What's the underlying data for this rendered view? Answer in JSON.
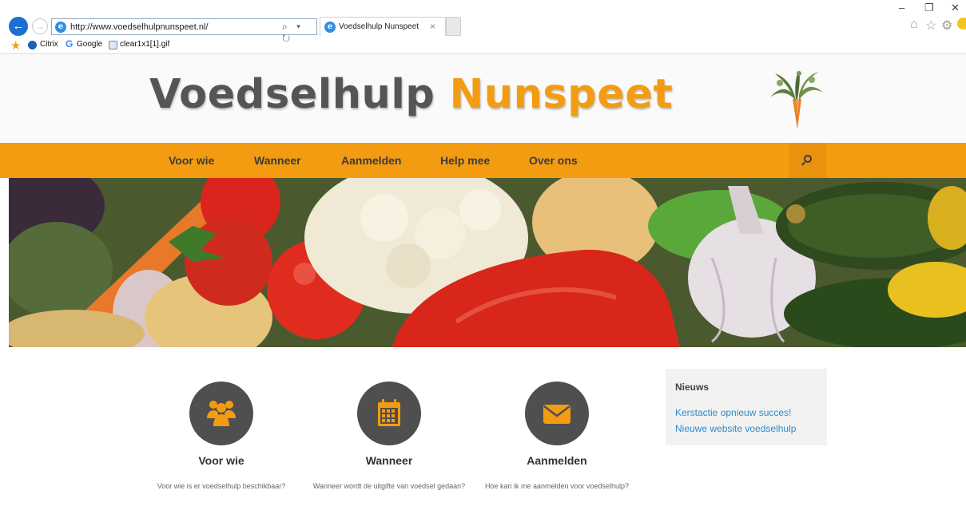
{
  "browser": {
    "url": "http://www.voedselhulpnunspeet.nl/",
    "tab_title": "Voedselhulp Nunspeet",
    "tab_close": "×",
    "nav_back": "←",
    "nav_forward": "→",
    "address_tools": "⌕ ▾ ↻",
    "window_controls": {
      "minimize": "–",
      "restore": "❐",
      "close": "✕"
    },
    "toolbar_icons": [
      "home-icon",
      "favorites-star-icon",
      "settings-gear-icon",
      "feedback-smiley-icon"
    ],
    "favorites": [
      {
        "label": "Citrix",
        "icon": "citrix-icon",
        "color": "#1d5fb8"
      },
      {
        "label": "Google",
        "icon": "google-icon",
        "color": "#4285f4"
      },
      {
        "label": "clear1x1[1].gif",
        "icon": "gif-file-icon",
        "color": "#6a8bb8"
      }
    ]
  },
  "site": {
    "logo": {
      "word1": "Voedselhulp",
      "word2": "Nunspeet",
      "color1": "#555555",
      "color2": "#f39c12"
    },
    "menu": [
      "Voor wie",
      "Wanneer",
      "Aanmelden",
      "Help mee",
      "Over ons"
    ],
    "accent": "#f39c12",
    "features": [
      {
        "icon": "users-group-icon",
        "title": "Voor wie",
        "text": "Voor wie is er voedselhulp beschikbaar?"
      },
      {
        "icon": "calendar-icon",
        "title": "Wanneer",
        "text": "Wanneer wordt de uitgifte van voedsel gedaan?"
      },
      {
        "icon": "envelope-icon",
        "title": "Aanmelden",
        "text": "Hoe kan ik me aanmelden voor voedselhulp?"
      }
    ],
    "news": {
      "heading": "Nieuws",
      "items": [
        "Kerstactie opnieuw succes!",
        "Nieuwe website voedselhulp"
      ]
    }
  }
}
